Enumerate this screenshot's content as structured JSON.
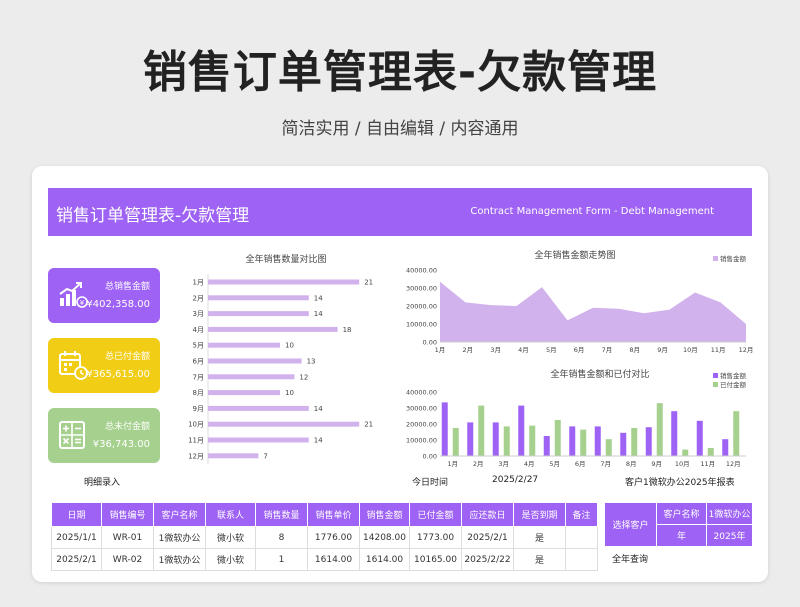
{
  "header": {
    "title": "销售订单管理表-欠款管理",
    "subtitle": "简洁实用 / 自由编辑 / 内容通用"
  },
  "banner": {
    "title": "销售订单管理表-欠款管理",
    "english": "Contract Management Form - Debt Management"
  },
  "kpis": [
    {
      "label": "总销售金额",
      "value": "¥402,358.00",
      "color": "#9e62f4",
      "icon": "chart-growth-icon"
    },
    {
      "label": "总已付金额",
      "value": "¥365,615.00",
      "color": "#f1cd16",
      "icon": "calendar-clock-icon"
    },
    {
      "label": "总未付金额",
      "value": "¥36,743.00",
      "color": "#a5d08d",
      "icon": "calculator-icon"
    }
  ],
  "labels": {
    "detail_entry": "明细录入",
    "today_label": "今日时间",
    "today_value": "2025/2/27",
    "report_title": "客户1微软办公2025年报表",
    "select_customer": "选择客户",
    "customer_name_label": "客户名称",
    "customer_name_value": "1微软办公",
    "year_label": "年",
    "year_value": "2025年",
    "year_query": "全年查询"
  },
  "chart_data": [
    {
      "type": "bar",
      "orientation": "horizontal",
      "title": "全年销售数量对比图",
      "categories": [
        "1月",
        "2月",
        "3月",
        "4月",
        "5月",
        "6月",
        "7月",
        "8月",
        "9月",
        "10月",
        "11月",
        "12月"
      ],
      "values": [
        21,
        14,
        14,
        18,
        10,
        13,
        12,
        10,
        14,
        21,
        14,
        7
      ],
      "xlim": [
        0,
        25
      ],
      "color": "#d2b2ec"
    },
    {
      "type": "area",
      "title": "全年销售金额走势图",
      "categories": [
        "1月",
        "2月",
        "3月",
        "4月",
        "5月",
        "6月",
        "7月",
        "8月",
        "9月",
        "10月",
        "11月",
        "12月"
      ],
      "series": [
        {
          "name": "销售金额",
          "values": [
            33500,
            22000,
            20500,
            20000,
            30500,
            12000,
            19000,
            18500,
            16000,
            18000,
            27500,
            22000,
            10000
          ]
        }
      ],
      "ylim": [
        0,
        40000
      ],
      "yticks": [
        "0.00",
        "10000.00",
        "20000.00",
        "30000.00",
        "40000.00"
      ],
      "legend": "top-right",
      "color": "#d2b2ec"
    },
    {
      "type": "bar",
      "title": "全年销售金额和已付对比",
      "categories": [
        "1月",
        "2月",
        "3月",
        "4月",
        "5月",
        "6月",
        "7月",
        "8月",
        "9月",
        "10月",
        "11月",
        "12月"
      ],
      "series": [
        {
          "name": "销售金额",
          "values": [
            33500,
            21000,
            21000,
            31500,
            12500,
            18500,
            18500,
            14500,
            18000,
            28000,
            22000,
            10500
          ],
          "color": "#9e62f4"
        },
        {
          "name": "已付金额",
          "values": [
            17500,
            31500,
            18500,
            19000,
            22500,
            16500,
            10500,
            17500,
            33000,
            4000,
            5000,
            28000
          ],
          "color": "#a5d08d"
        }
      ],
      "ylim": [
        0,
        40000
      ],
      "yticks": [
        "0.00",
        "10000.00",
        "20000.00",
        "30000.00",
        "40000.00"
      ],
      "legend": "top-right"
    }
  ],
  "table": {
    "headers": [
      "日期",
      "销售编号",
      "客户名称",
      "联系人",
      "销售数量",
      "销售单价",
      "销售金额",
      "已付金额",
      "应还款日",
      "是否到期",
      "备注"
    ],
    "rows": [
      [
        "2025/1/1",
        "WR-01",
        "1微软办公",
        "微小软",
        "8",
        "1776.00",
        "14208.00",
        "1773.00",
        "2025/2/1",
        "是",
        ""
      ],
      [
        "2025/2/1",
        "WR-02",
        "1微软办公",
        "微小软",
        "1",
        "1614.00",
        "1614.00",
        "10165.00",
        "2025/2/22",
        "是",
        ""
      ]
    ]
  }
}
